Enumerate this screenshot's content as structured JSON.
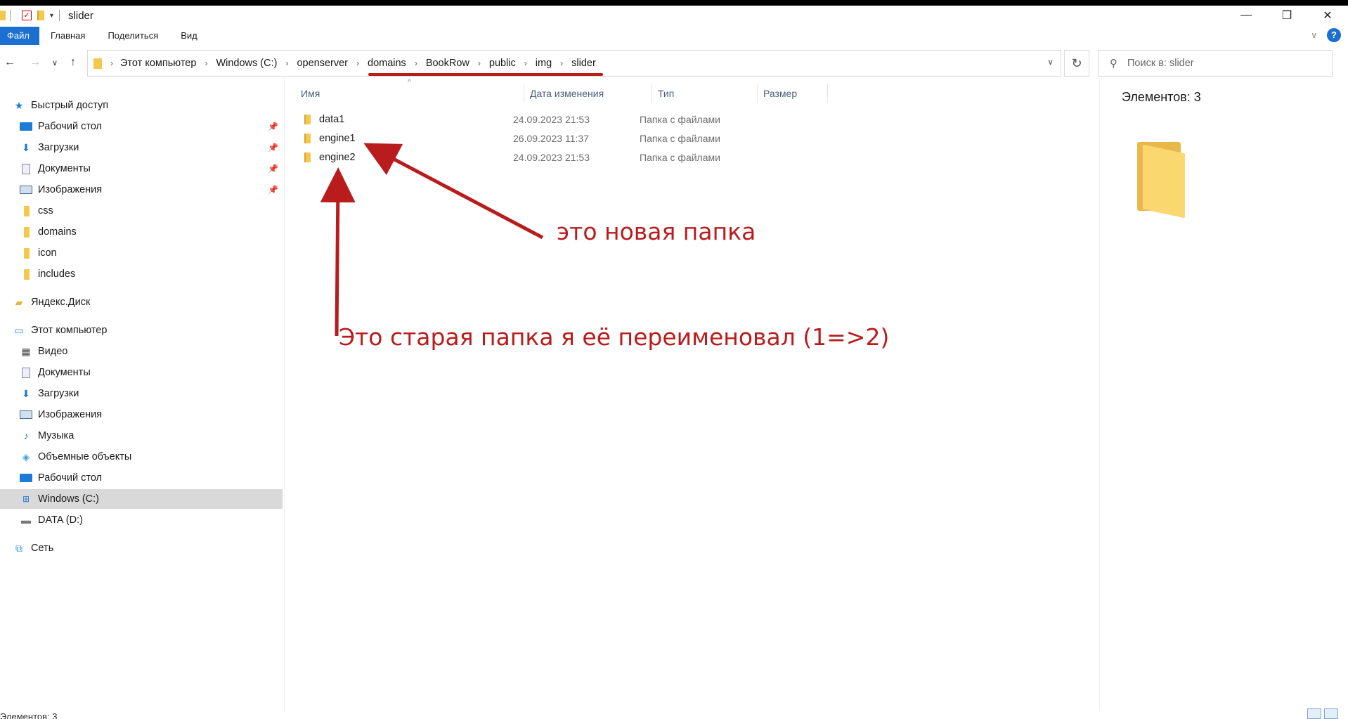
{
  "window": {
    "title": "slider",
    "controls": {
      "minimize": "—",
      "restore": "❐",
      "close": "✕"
    }
  },
  "ribbon": {
    "tabs": [
      {
        "label": "Файл",
        "active": true
      },
      {
        "label": "Главная"
      },
      {
        "label": "Поделиться"
      },
      {
        "label": "Вид"
      }
    ],
    "help": "?"
  },
  "address": {
    "crumbs": [
      "Этот компьютер",
      "Windows (C:)",
      "openserver",
      "domains",
      "BookRow",
      "public",
      "img",
      "slider"
    ]
  },
  "search": {
    "placeholder": "Поиск в: slider"
  },
  "sidebar": {
    "quick_access": "Быстрый доступ",
    "quick_items": [
      "Рабочий стол",
      "Загрузки",
      "Документы",
      "Изображения",
      "css",
      "domains",
      "icon",
      "includes"
    ],
    "yandex": "Яндекс.Диск",
    "this_pc": "Этот компьютер",
    "pc_items": [
      "Видео",
      "Документы",
      "Загрузки",
      "Изображения",
      "Музыка",
      "Объемные объекты",
      "Рабочий стол",
      "Windows (C:)",
      "DATA (D:)"
    ],
    "network": "Сеть",
    "selected": "Windows (C:)"
  },
  "columns": [
    "Имя",
    "Дата изменения",
    "Тип",
    "Размер"
  ],
  "files": [
    {
      "name": "data1",
      "date": "24.09.2023 21:53",
      "type": "Папка с файлами"
    },
    {
      "name": "engine1",
      "date": "26.09.2023 11:37",
      "type": "Папка с файлами"
    },
    {
      "name": "engine2",
      "date": "24.09.2023 21:53",
      "type": "Папка с файлами"
    }
  ],
  "details": {
    "count": "Элементов: 3"
  },
  "annotations": {
    "new_folder": "это новая папка",
    "old_folder": "Это старая папка я её переименовал (1=>2)",
    "color": "#b91c1c"
  },
  "status": {
    "count": "Элементов: 3"
  }
}
